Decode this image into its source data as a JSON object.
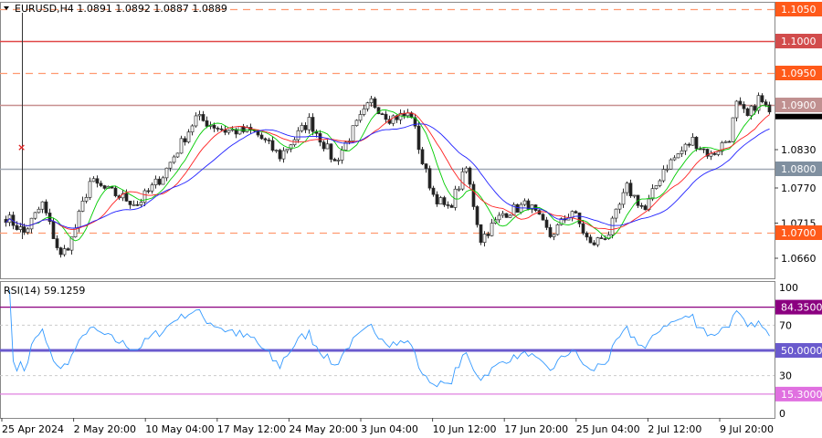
{
  "header": {
    "symbol": "EURUSD,H4",
    "open": "1.0891",
    "high": "1.0892",
    "low": "1.0887",
    "close": "1.0889"
  },
  "rsi_header": {
    "label": "RSI(14)",
    "value": "59.1259"
  },
  "colors": {
    "fast_ma": "#00cc00",
    "mid_ma": "#ff2020",
    "slow_ma": "#2020ff",
    "rsi": "#3399ff",
    "candle": "#303030"
  },
  "chart_data": {
    "type": "candlestick",
    "title": "EURUSD,H4",
    "ylim": [
      1.065,
      1.1062
    ],
    "price_ticks": [
      "1.0830",
      "1.0770",
      "1.0715",
      "1.0660"
    ],
    "levels": [
      {
        "label": "1.1050",
        "price": 1.105,
        "style": "dashed",
        "color": "#ff9a70",
        "box": "#ff5a1a"
      },
      {
        "label": "1.1000",
        "price": 1.1,
        "style": "solid",
        "color": "#e04848",
        "box": "#d24c4c"
      },
      {
        "label": "1.0950",
        "price": 1.095,
        "style": "dashed",
        "color": "#ff9a70",
        "box": "#ff5a1a"
      },
      {
        "label": "1.0900",
        "price": 1.09,
        "style": "solid",
        "color": "#c89090",
        "box": "#c09090"
      },
      {
        "label": "1.0800",
        "price": 1.08,
        "style": "solid",
        "color": "#a0a8b4",
        "box": "#8090a0"
      },
      {
        "label": "1.0700",
        "price": 1.07,
        "style": "dashed",
        "color": "#ff9a70",
        "box": "#ff5a1a"
      }
    ],
    "current_price": "1.0889",
    "price_path": [
      [
        0,
        1.0725
      ],
      [
        5,
        1.07
      ],
      [
        10,
        1.0745
      ],
      [
        15,
        1.0662
      ],
      [
        18,
        1.069
      ],
      [
        23,
        1.078
      ],
      [
        28,
        1.0765
      ],
      [
        36,
        1.0745
      ],
      [
        43,
        1.079
      ],
      [
        52,
        1.088
      ],
      [
        60,
        1.086
      ],
      [
        68,
        1.0858
      ],
      [
        75,
        1.082
      ],
      [
        83,
        1.0875
      ],
      [
        88,
        1.083
      ],
      [
        90,
        1.081
      ],
      [
        95,
        1.086
      ],
      [
        100,
        1.0905
      ],
      [
        105,
        1.088
      ],
      [
        111,
        1.0885
      ],
      [
        114,
        1.081
      ],
      [
        117,
        1.076
      ],
      [
        121,
        1.0735
      ],
      [
        126,
        1.08
      ],
      [
        130,
        1.069
      ],
      [
        136,
        1.073
      ],
      [
        143,
        1.0745
      ],
      [
        149,
        1.0695
      ],
      [
        155,
        1.0735
      ],
      [
        160,
        1.068
      ],
      [
        165,
        1.07
      ],
      [
        170,
        1.077
      ],
      [
        175,
        1.0735
      ],
      [
        180,
        1.08
      ],
      [
        188,
        1.0845
      ],
      [
        193,
        1.082
      ],
      [
        198,
        1.085
      ],
      [
        200,
        1.09
      ],
      [
        203,
        1.088
      ],
      [
        206,
        1.091
      ],
      [
        209,
        1.0889
      ]
    ],
    "time_labels": [
      "25 Apr 2024",
      "2 May 20:00",
      "10 May 04:00",
      "17 May 12:00",
      "24 May 20:00",
      "3 Jun 04:00",
      "10 Jun 12:00",
      "17 Jun 20:00",
      "25 Jun 04:00",
      "2 Jul 12:00",
      "9 Jul 20:00"
    ],
    "moving_averages": [
      {
        "name": "fast",
        "period": 8
      },
      {
        "name": "mid",
        "period": 14
      },
      {
        "name": "slow",
        "period": 24
      }
    ],
    "rsi": {
      "period": 14,
      "ylim": [
        0,
        100
      ],
      "ticks": [
        "100",
        "70",
        "30",
        "0"
      ],
      "levels": [
        {
          "label": "84.3500",
          "value": 84.35,
          "color": "#8b0080",
          "box": "#8b0080"
        },
        {
          "label": "50.0000",
          "value": 50,
          "color": "#6a5acd",
          "box": "#6a5acd"
        },
        {
          "label": "15.3000",
          "value": 15.3,
          "color": "#e080e0",
          "box": "#e070e0"
        }
      ]
    }
  }
}
